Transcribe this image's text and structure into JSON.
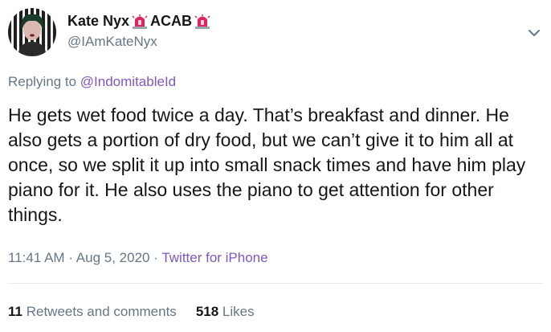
{
  "author": {
    "display_name": "Kate Nyx",
    "badge_text": "ACAB",
    "handle": "@IAmKateNyx",
    "siren_emoji_color": "#e0245e"
  },
  "reply": {
    "prefix": "Replying to",
    "to": "@IndomitableId"
  },
  "tweet": {
    "text": "He gets wet food twice a day. That’s breakfast and dinner. He also gets a portion of dry food, but we can’t give it to him all at once, so we split it up into small snack times and have him play piano for it. He also uses the piano to get attention for other things.",
    "time": "11:41 AM",
    "separator": "·",
    "date": "Aug 5, 2020",
    "source": "Twitter for iPhone"
  },
  "stats": {
    "retweets_count": "11",
    "retweets_label": "Retweets and comments",
    "likes_count": "518",
    "likes_label": "Likes"
  },
  "colors": {
    "link": "#7e57c2",
    "secondary_text": "#657786",
    "primary_text": "#14171a"
  }
}
